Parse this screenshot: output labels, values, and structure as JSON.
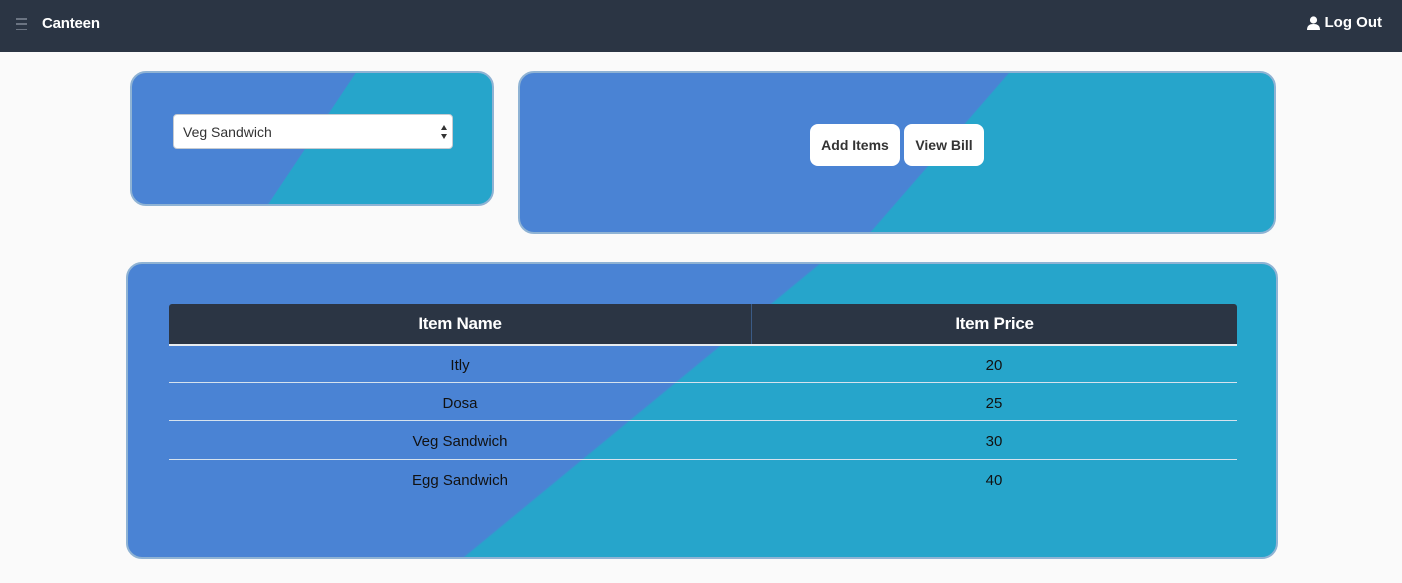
{
  "navbar": {
    "brand": "Canteen",
    "logout_label": "Log Out",
    "icons": [
      "menu-icon",
      "user-icon"
    ]
  },
  "selector": {
    "selected_value": "Veg Sandwich"
  },
  "actions": {
    "add_items_label": "Add Items",
    "view_bill_label": "View Bill"
  },
  "table": {
    "headers": [
      "Item Name",
      "Item Price"
    ],
    "rows": [
      {
        "name": "Itly",
        "price": "20"
      },
      {
        "name": "Dosa",
        "price": "25"
      },
      {
        "name": "Veg Sandwich",
        "price": "30"
      },
      {
        "name": "Egg Sandwich",
        "price": "40"
      }
    ]
  },
  "colors": {
    "navbar": "#2b3544",
    "panel_blue": "#4a83d4",
    "panel_teal": "#26a5cb",
    "panel_border": "#8fb3d4"
  }
}
